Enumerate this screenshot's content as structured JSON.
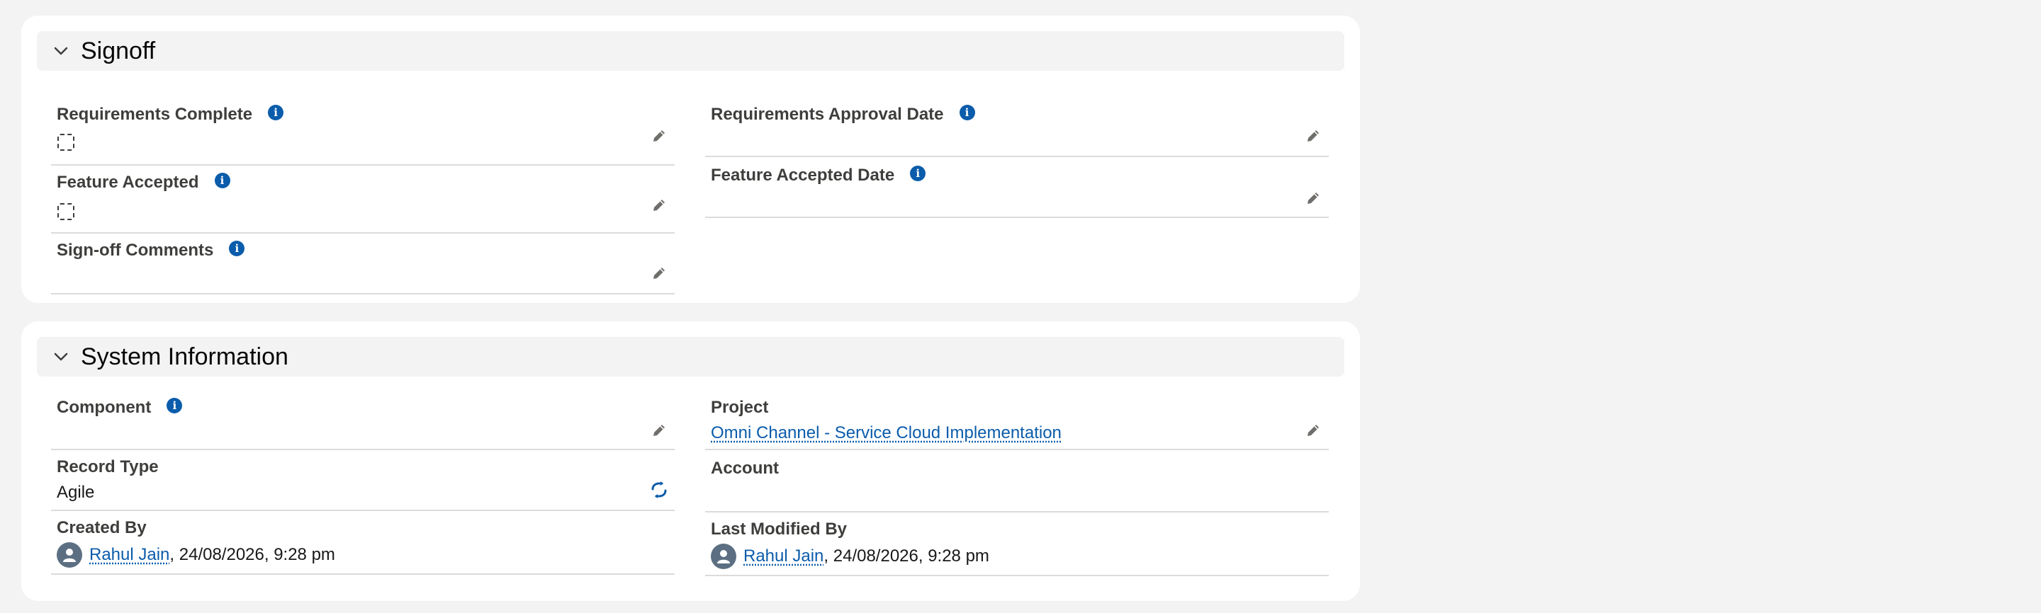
{
  "signoff": {
    "title": "Signoff",
    "fields": {
      "requirements_complete": {
        "label": "Requirements Complete"
      },
      "requirements_approval_date": {
        "label": "Requirements Approval Date"
      },
      "feature_accepted": {
        "label": "Feature Accepted"
      },
      "feature_accepted_date": {
        "label": "Feature Accepted Date"
      },
      "signoff_comments": {
        "label": "Sign-off Comments"
      }
    }
  },
  "system_info": {
    "title": "System Information",
    "fields": {
      "component": {
        "label": "Component"
      },
      "project": {
        "label": "Project",
        "value": "Omni Channel - Service Cloud Implementation"
      },
      "record_type": {
        "label": "Record Type",
        "value": "Agile"
      },
      "account": {
        "label": "Account"
      },
      "created_by": {
        "label": "Created By",
        "user": "Rahul Jain",
        "timestamp": ", 24/08/2026, 9:28 pm"
      },
      "last_modified_by": {
        "label": "Last Modified By",
        "user": "Rahul Jain",
        "timestamp": ", 24/08/2026, 9:28 pm"
      }
    }
  },
  "icons": {
    "info": "info-icon",
    "edit": "pencil-icon",
    "chevron": "chevron-down-icon",
    "record_type_change": "change-record-type-icon",
    "avatar": "user-avatar-icon"
  },
  "colors": {
    "link": "#0b5cab",
    "info_icon": "#0b5cab",
    "section_header_bg": "#f3f3f3",
    "card_bg": "#ffffff"
  }
}
